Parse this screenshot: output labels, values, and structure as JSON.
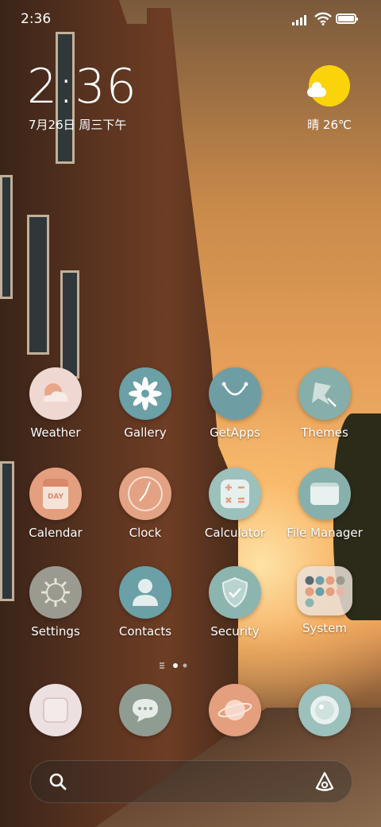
{
  "status_bar": {
    "time": "2:36"
  },
  "lock_clock": {
    "time": "2:36",
    "date": "7月26日 周三下午"
  },
  "weather_widget": {
    "text": "晴 26℃"
  },
  "apps": [
    {
      "name": "weather",
      "label": "Weather"
    },
    {
      "name": "gallery",
      "label": "Gallery"
    },
    {
      "name": "getapps",
      "label": "GetApps"
    },
    {
      "name": "themes",
      "label": "Themes"
    },
    {
      "name": "calendar",
      "label": "Calendar",
      "icon_text": "DAY"
    },
    {
      "name": "clock",
      "label": "Clock"
    },
    {
      "name": "calculator",
      "label": "Calculator"
    },
    {
      "name": "file-manager",
      "label": "File Manager"
    },
    {
      "name": "settings",
      "label": "Settings"
    },
    {
      "name": "contacts",
      "label": "Contacts"
    },
    {
      "name": "security",
      "label": "Security"
    },
    {
      "name": "system",
      "label": "System"
    }
  ],
  "dock": [
    "phone",
    "messages",
    "browser",
    "camera"
  ],
  "colors": {
    "accent_teal": "#8ab8b4",
    "sun": "#fbd30b",
    "peach": "#e8a383"
  }
}
